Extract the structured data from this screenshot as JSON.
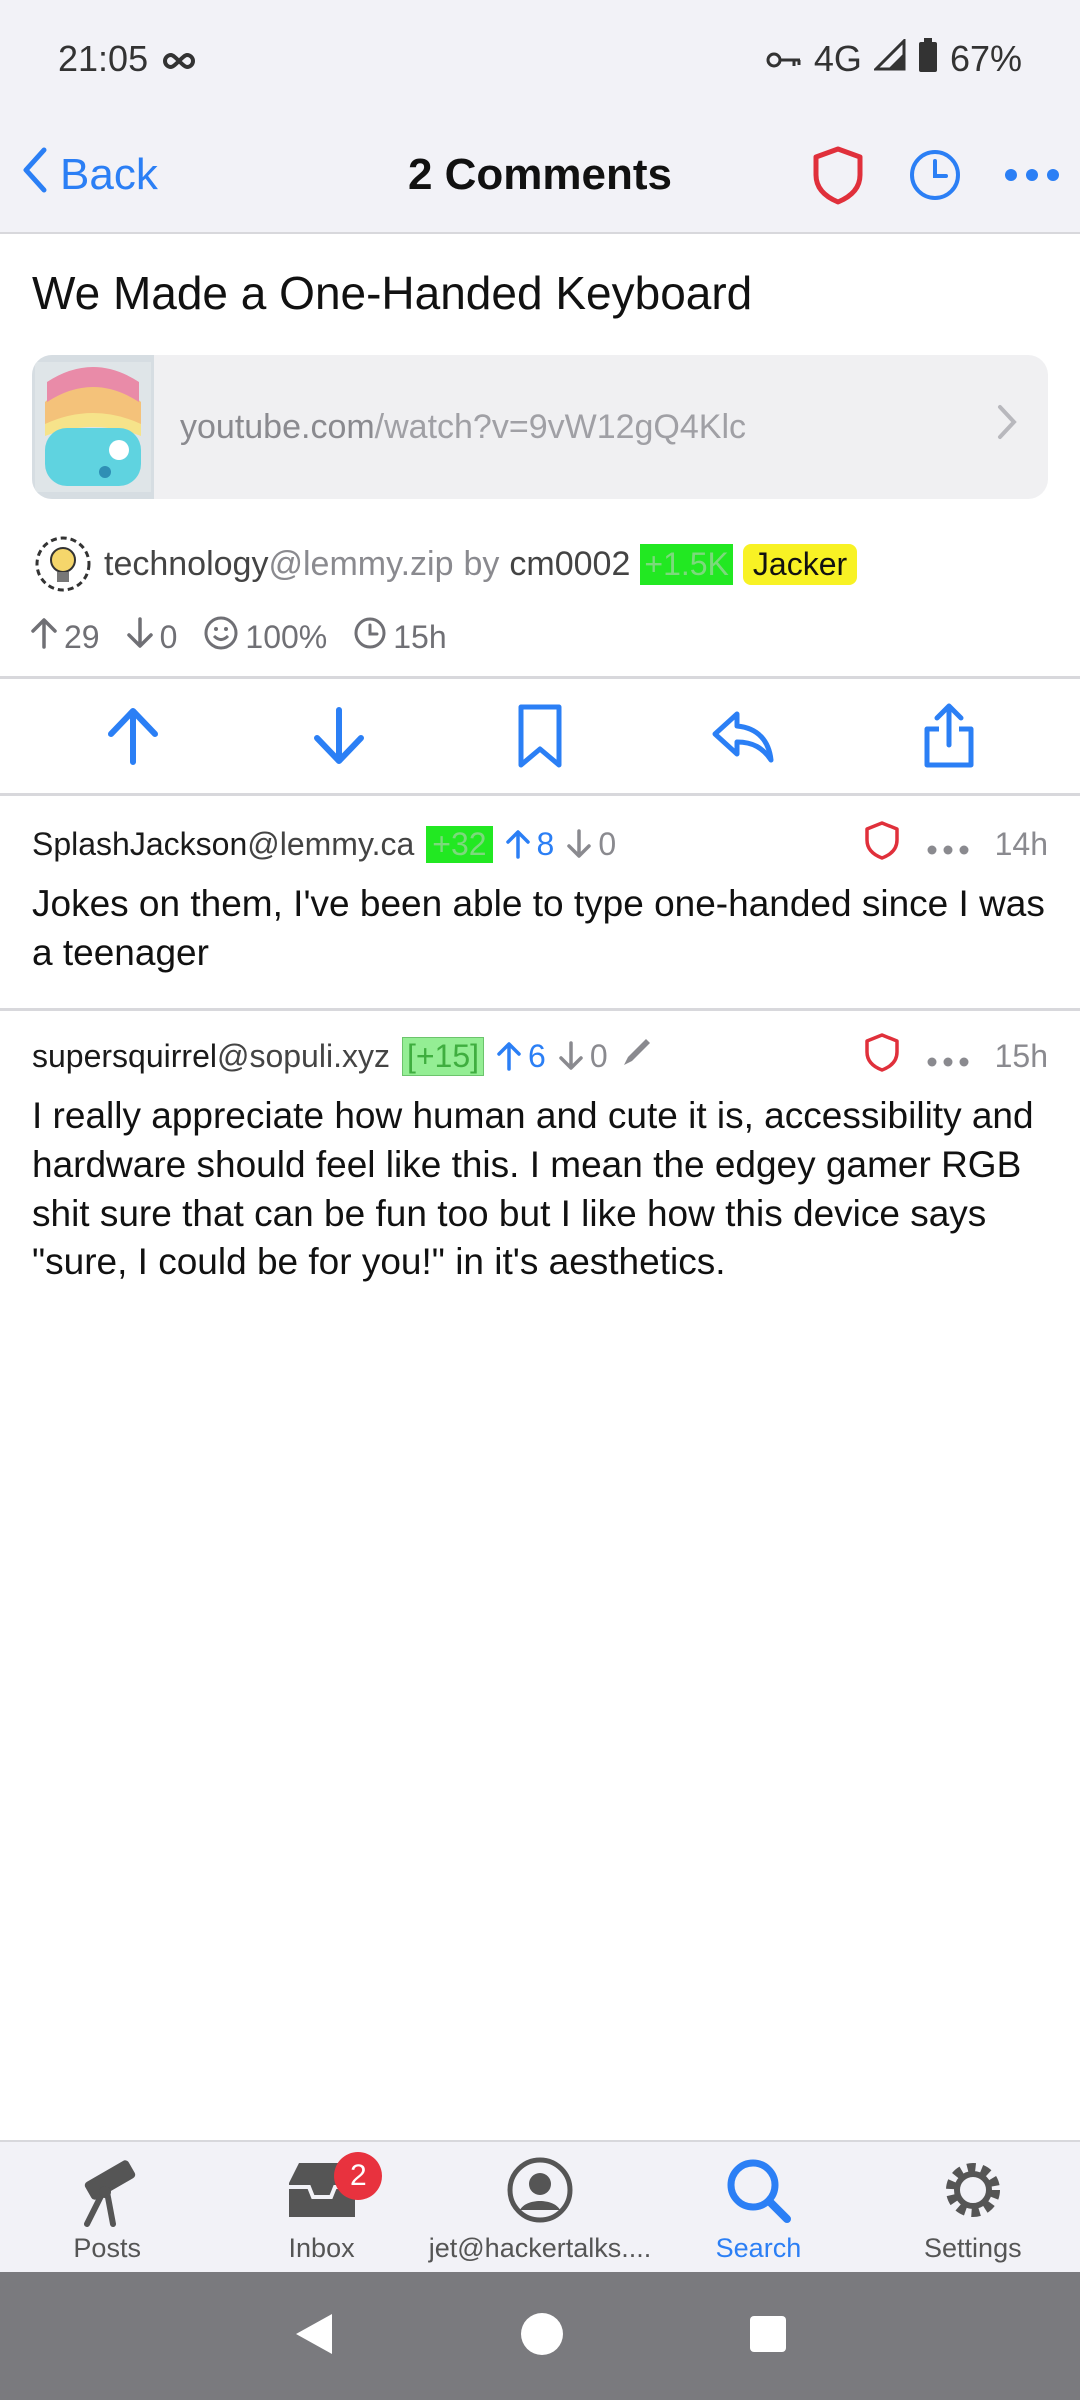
{
  "status_bar": {
    "time": "21:05",
    "network": "4G",
    "battery": "67%"
  },
  "nav": {
    "back_label": "Back",
    "title": "2 Comments"
  },
  "post": {
    "title": "We Made a One-Handed Keyboard",
    "link": {
      "host": "youtube.com",
      "path": "/watch?v=9vW12gQ4Klc"
    },
    "community": "technology",
    "community_instance": "@lemmy.zip",
    "by_label": "by",
    "author": "cm0002",
    "author_score_tag": "+1.5K",
    "flair": "Jacker",
    "upvotes": "29",
    "downvotes": "0",
    "upvote_ratio": "100%",
    "age": "15h"
  },
  "comments": [
    {
      "user": "SplashJackson",
      "instance": "@lemmy.ca",
      "score_tag": "+32",
      "upvotes": "8",
      "downvotes": "0",
      "age": "14h",
      "body": "Jokes on them, I've been able to type one-handed since I was a teenager"
    },
    {
      "user": "supersquirrel",
      "instance": "@sopuli.xyz",
      "score_tag": "[+15]",
      "upvotes": "6",
      "downvotes": "0",
      "age": "15h",
      "body": "I really appreciate how human and cute it is, accessibility and hardware should feel like this. I mean the edgey gamer RGB shit sure that can be fun too but I like how this device says \"sure, I could be for you!\" in it's aesthetics."
    }
  ],
  "tabs": [
    {
      "label": "Posts",
      "icon": "telescope-icon"
    },
    {
      "label": "Inbox",
      "icon": "inbox-icon",
      "badge": "2"
    },
    {
      "label": "jet@hackertalks....",
      "icon": "account-icon"
    },
    {
      "label": "Search",
      "icon": "search-icon"
    },
    {
      "label": "Settings",
      "icon": "gear-icon"
    }
  ],
  "colors": {
    "accent": "#2b7ff5",
    "shield": "#e0303b",
    "badge": "#e8323e",
    "green_tag": "#22e822",
    "yellow_tag": "#f8f224"
  }
}
